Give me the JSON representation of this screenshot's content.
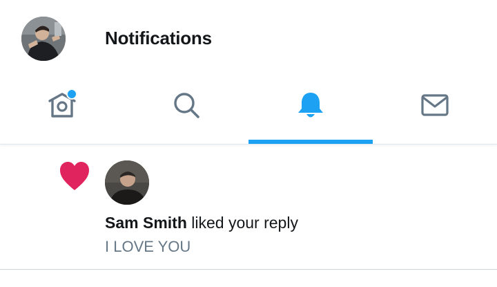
{
  "header": {
    "title": "Notifications"
  },
  "tabs": [
    {
      "name": "home",
      "icon": "home-icon",
      "has_unread": true
    },
    {
      "name": "search",
      "icon": "search-icon"
    },
    {
      "name": "notifications",
      "icon": "bell-icon",
      "active": true
    },
    {
      "name": "messages",
      "icon": "mail-icon"
    }
  ],
  "notifications": [
    {
      "type_icon": "heart-icon",
      "actor_name": "Sam Smith",
      "action_text": " liked your reply",
      "tweet_text": "I LOVE YOU"
    }
  ],
  "colors": {
    "accent": "#1da1f2",
    "like": "#e0245e",
    "icon_gray": "#657786",
    "secondary_text": "#657786"
  }
}
